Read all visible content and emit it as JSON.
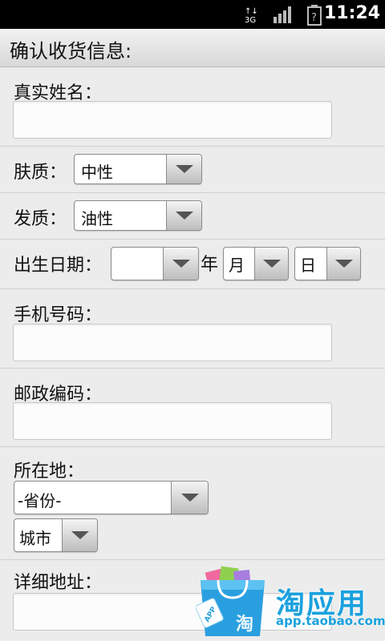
{
  "status_bar": {
    "time": "11:24",
    "icons": [
      "data-arrows-icon",
      "signal-bars-icon",
      "battery-unknown-icon"
    ]
  },
  "header": {
    "title": "确认收货信息:"
  },
  "form": {
    "real_name": {
      "label": "真实姓名：",
      "value": ""
    },
    "skin": {
      "label": "肤质：",
      "selected": "中性"
    },
    "hair": {
      "label": "发质：",
      "selected": "油性"
    },
    "birthday": {
      "label": "出生日期：",
      "year_selected": "",
      "year_suffix": "年",
      "month_selected": "月",
      "day_selected": "日"
    },
    "phone": {
      "label": "手机号码：",
      "value": ""
    },
    "postcode": {
      "label": "邮政编码：",
      "value": ""
    },
    "location": {
      "label": "所在地：",
      "province_selected": "-省份-",
      "city_selected": "城市"
    },
    "address": {
      "label": "详细地址：",
      "value": ""
    }
  },
  "ad": {
    "brand": "淘应用",
    "url": "app.taobao.com",
    "badge": "APP",
    "bag_char": "淘",
    "colors": {
      "brand": "#1aa1de",
      "bag": "#2a9fe0"
    }
  }
}
